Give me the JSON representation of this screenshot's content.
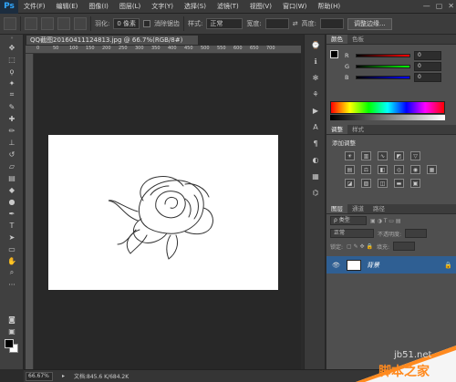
{
  "app": {
    "logo": "Ps"
  },
  "menu": [
    "文件(F)",
    "编辑(E)",
    "图像(I)",
    "图层(L)",
    "文字(Y)",
    "选择(S)",
    "滤镜(T)",
    "视图(V)",
    "窗口(W)",
    "帮助(H)"
  ],
  "window_controls": [
    "—",
    "▢",
    "✕"
  ],
  "options": {
    "feather_label": "羽化:",
    "feather_value": "0 像素",
    "antialias_label": "消除锯齿",
    "style_label": "样式:",
    "style_value": "正常",
    "width_label": "宽度:",
    "height_label": "高度:",
    "refine_edge": "调整边缘..."
  },
  "document": {
    "tab_title": "QQ截图20160411124813.jpg @ 66.7%(RGB/8#)",
    "zoom": "66.67%",
    "doc_size": "文档:845.6 K/684.2K",
    "ruler_top": [
      "0",
      "50",
      "100",
      "150",
      "200",
      "250",
      "300",
      "350",
      "400",
      "450",
      "500",
      "550",
      "600",
      "650",
      "700"
    ]
  },
  "color_panel": {
    "tabs": [
      "颜色",
      "色板"
    ],
    "sliders": [
      {
        "label": "R",
        "value": "0"
      },
      {
        "label": "G",
        "value": "0"
      },
      {
        "label": "B",
        "value": "0"
      }
    ]
  },
  "adjust_panel": {
    "tabs": [
      "调整",
      "样式"
    ],
    "title": "添加调整"
  },
  "layers_panel": {
    "tabs": [
      "图层",
      "通道",
      "路径"
    ],
    "kind_label": "ρ 类型",
    "blend_mode": "正常",
    "opacity_label": "不透明度:",
    "lock_label": "锁定:",
    "fill_label": "填充:",
    "layer_name": "背景"
  },
  "watermark": {
    "line1": "jb51.net",
    "line2": "脚本之家"
  },
  "colors": {
    "accent": "#2f5f93",
    "watermark_orange": "#ff8a1f"
  }
}
